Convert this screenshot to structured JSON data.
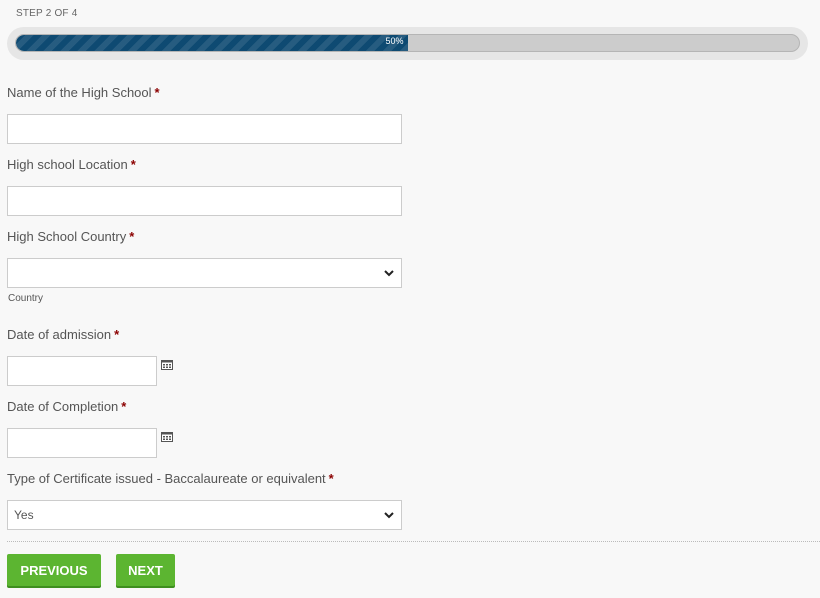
{
  "progress": {
    "step_label": "STEP 2 OF 4",
    "percent_text": "50%",
    "percent": 50
  },
  "required_marker": "*",
  "fields": {
    "school_name": {
      "label": "Name of the High School",
      "value": ""
    },
    "school_location": {
      "label": "High school Location",
      "value": ""
    },
    "school_country": {
      "label": "High School Country",
      "value": "",
      "help": "Country"
    },
    "admission_date": {
      "label": "Date of admission",
      "value": ""
    },
    "completion_date": {
      "label": "Date of Completion",
      "value": ""
    },
    "certificate_type": {
      "label": "Type of Certificate issued - Baccalaureate or equivalent",
      "value": "Yes"
    }
  },
  "buttons": {
    "previous": "PREVIOUS",
    "next": "NEXT"
  },
  "icons": {
    "select_arrow": "chevron-down-icon",
    "date_picker": "calendar-icon"
  },
  "colors": {
    "progress_fill": "#0e4a72",
    "button_green": "#5cb531",
    "required": "#8b0000"
  }
}
